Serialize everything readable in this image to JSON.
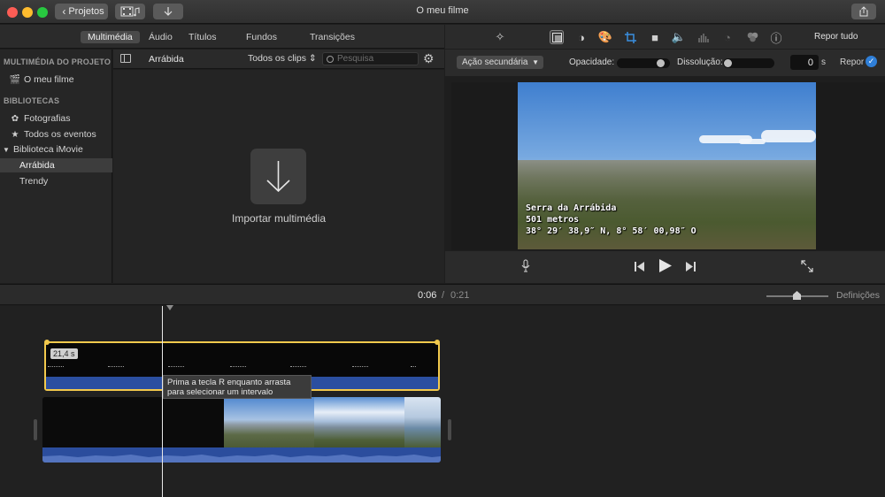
{
  "window": {
    "title": "O meu filme",
    "projects_label": "Projetos"
  },
  "browser_tabs": [
    "Multimédia",
    "Áudio",
    "Títulos",
    "Fundos",
    "Transições"
  ],
  "sidebar": {
    "project_heading": "MULTIMÉDIA DO PROJETO",
    "project_item": "O meu filme",
    "libraries_heading": "BIBLIOTECAS",
    "items": [
      "Fotografias",
      "Todos os eventos"
    ],
    "library": "Biblioteca iMovie",
    "events": [
      "Arrábida",
      "Trendy"
    ],
    "selected_event": "Arrábida"
  },
  "browser": {
    "title": "Arrábida",
    "filter": "Todos os clips",
    "search_placeholder": "Pesquisa",
    "import_label": "Importar multimédia"
  },
  "viewer_toolbar": {
    "reset_all": "Repor tudo",
    "icons": [
      "magic-wand-icon",
      "crop-overlay-icon",
      "color-balance-icon",
      "color-palette-icon",
      "crop-icon",
      "stabilization-icon",
      "volume-icon",
      "equalizer-icon",
      "speed-icon",
      "filter-icon",
      "info-icon"
    ]
  },
  "adjustments": {
    "overlay_mode": "Ação secundária",
    "opacity_label": "Opacidade:",
    "opacity_value": 0.9,
    "dissolve_label": "Dissolução:",
    "dissolve_value": 0,
    "dissolve_seconds": "0",
    "unit": "s",
    "reset_label": "Repor"
  },
  "video_overlay": {
    "line1": "Serra da Arrábida",
    "line2": "501 metros",
    "line3": "38° 29′ 38,9″ N, 8° 58′ 00,98″ O"
  },
  "timeline": {
    "current_time": "0:06",
    "separator": "/",
    "total_time": "0:21",
    "settings_label": "Definições",
    "title_clip_duration": "21,4 s",
    "tooltip": "Prima a tecla R enquanto arrasta para selecionar um intervalo"
  },
  "colors": {
    "accent": "#2f7fd8",
    "selection": "#f2c94c",
    "audio": "#2b4fa0"
  }
}
